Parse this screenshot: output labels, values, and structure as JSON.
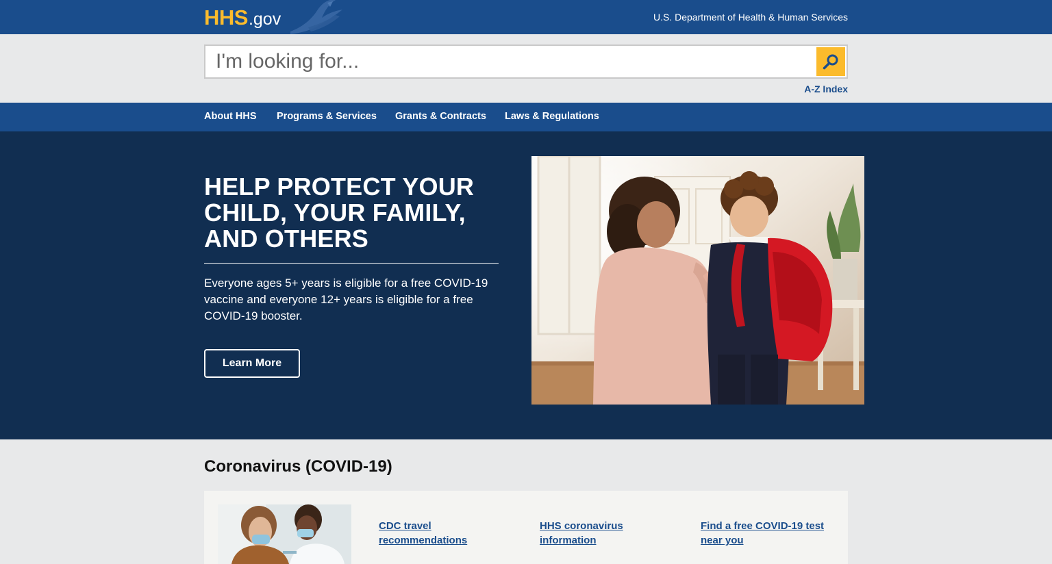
{
  "header": {
    "logo_hhs": "HHS",
    "logo_gov": ".gov",
    "dept_name": "U.S. Department of Health & Human Services"
  },
  "search": {
    "placeholder": "I'm looking for...",
    "value": "",
    "button_icon": "search-icon"
  },
  "az_index": "A-Z Index",
  "nav": {
    "items": [
      {
        "label": "About HHS"
      },
      {
        "label": "Programs & Services"
      },
      {
        "label": "Grants & Contracts"
      },
      {
        "label": "Laws & Regulations"
      }
    ]
  },
  "hero": {
    "title": "HELP PROTECT YOUR CHILD, YOUR FAMILY, AND OTHERS",
    "description": "Everyone ages 5+ years is eligible for a free COVID-19 vaccine and everyone 12+ years is eligible for a free COVID-19 booster.",
    "button_label": "Learn More"
  },
  "covid": {
    "heading": "Coronavirus (COVID-19)",
    "links": [
      {
        "label": "CDC travel recommendations"
      },
      {
        "label": "HHS coronavirus information"
      },
      {
        "label": "Find a free COVID-19 test near you"
      }
    ]
  },
  "colors": {
    "top_blue": "#1a4d8c",
    "hero_navy": "#112e51",
    "accent_gold": "#fbbb2c",
    "link_blue": "#1a4d8c",
    "page_gray": "#e8e9ea"
  }
}
